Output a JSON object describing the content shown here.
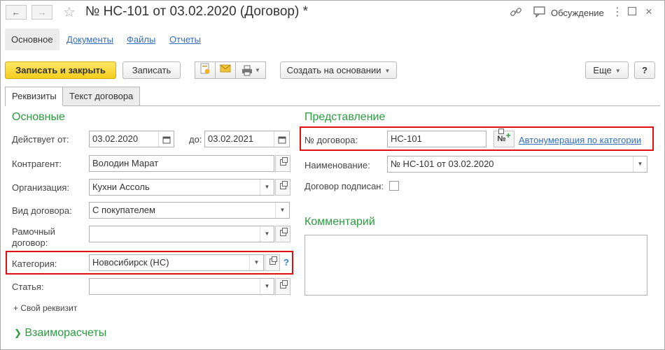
{
  "window": {
    "title": "№ НС-101 от 03.02.2020 (Договор) *",
    "discussion_label": "Обсуждение"
  },
  "nav_tabs": [
    "Основное",
    "Документы",
    "Файлы",
    "Отчеты"
  ],
  "toolbar": {
    "save_close": "Записать и закрыть",
    "save": "Записать",
    "create_based_on": "Создать на основании",
    "more": "Еще",
    "help": "?"
  },
  "page_tabs": [
    "Реквизиты",
    "Текст договора"
  ],
  "main": {
    "section_title": "Основные",
    "valid_from_label": "Действует от:",
    "valid_from": "03.02.2020",
    "valid_to_label": "до:",
    "valid_to": "03.02.2021",
    "counterparty_label": "Контрагент:",
    "counterparty": "Володин Марат",
    "organization_label": "Организация:",
    "organization": "Кухни Ассоль",
    "contract_type_label": "Вид договора:",
    "contract_type": "С покупателем",
    "frame_contract_label_1": "Рамочный",
    "frame_contract_label_2": "договор:",
    "frame_contract": "",
    "category_label": "Категория:",
    "category": "Новосибирск (НС)",
    "category_help": "?",
    "article_label": "Статья:",
    "article": "",
    "add_attribute": "+ Свой реквизит",
    "settlements": "Взаиморасчеты"
  },
  "presentation": {
    "section_title": "Представление",
    "number_label": "№ договора:",
    "number": "НС-101",
    "autonumber_link": "Автонумерация по категории",
    "name_label": "Наименование:",
    "name": "№ НС-101 от 03.02.2020",
    "signed_label": "Договор подписан:",
    "signed": false
  },
  "comment": {
    "section_title": "Комментарий",
    "value": ""
  },
  "colors": {
    "accent_green": "#2a9c3f",
    "link_blue": "#336ebe",
    "highlight_red": "#e01010",
    "primary_yellow": "#f4cd1c"
  }
}
